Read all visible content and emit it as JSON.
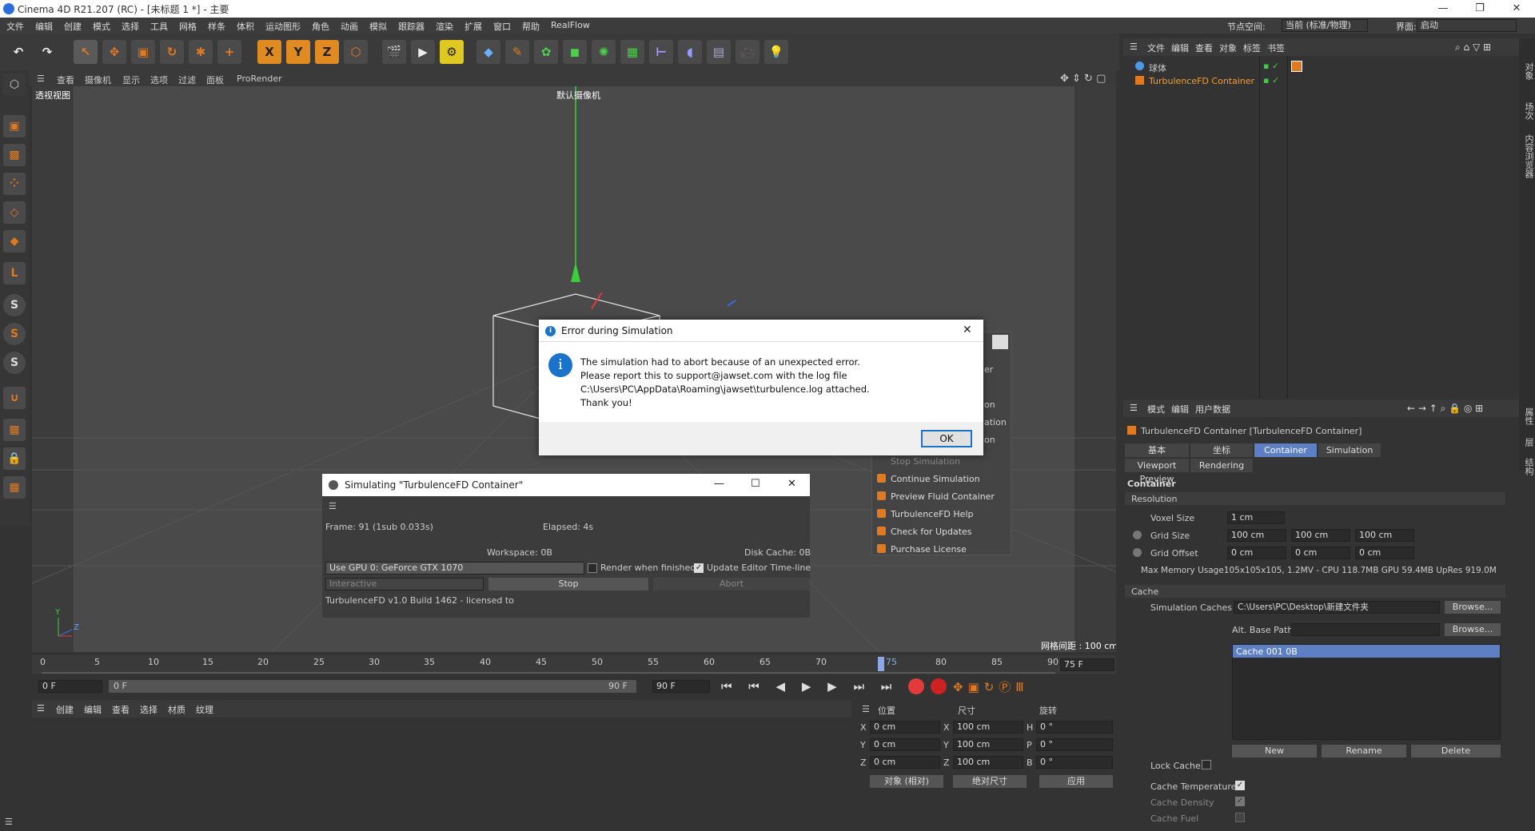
{
  "window": {
    "title": "Cinema 4D R21.207 (RC) - [未标题 1 *] - 主要"
  },
  "menubar": {
    "items": [
      "文件",
      "编辑",
      "创建",
      "模式",
      "选择",
      "工具",
      "网格",
      "样条",
      "体积",
      "运动图形",
      "角色",
      "动画",
      "模拟",
      "跟踪器",
      "渲染",
      "扩展",
      "窗口",
      "帮助",
      "RealFlow"
    ],
    "node_space_label": "节点空间:",
    "node_space_value": "当前 (标准/物理)",
    "interface_label": "界面:",
    "interface_value": "启动"
  },
  "viewport": {
    "menu": [
      "查看",
      "摄像机",
      "显示",
      "选项",
      "过滤",
      "面板",
      "ProRender"
    ],
    "view_name": "透视视图",
    "camera_label": "默认摄像机",
    "grid_spacing": "网格间距 : 100 cm"
  },
  "object_manager": {
    "menu": [
      "文件",
      "编辑",
      "查看",
      "对象",
      "标签",
      "书签"
    ],
    "objects": [
      "球体",
      "TurbulenceFD Container"
    ]
  },
  "attribute_manager": {
    "menu": [
      "模式",
      "编辑",
      "用户数据"
    ],
    "object_title": "TurbulenceFD Container [TurbulenceFD Container]",
    "tabs": [
      "基本",
      "坐标",
      "Container",
      "Simulation"
    ],
    "subtabs": [
      "Viewport Preview",
      "Rendering"
    ],
    "section": "Container",
    "resolution_group": "Resolution",
    "voxel_size_label": "Voxel Size",
    "voxel_size": "1 cm",
    "grid_size_label": "Grid Size",
    "grid_size": [
      "100 cm",
      "100 cm",
      "100 cm"
    ],
    "grid_offset_label": "Grid Offset",
    "grid_offset": [
      "0 cm",
      "0 cm",
      "0 cm"
    ],
    "max_memory": "Max Memory Usage105x105x105, 1.2MV - CPU 118.7MB GPU 59.4MB UpRes 919.0M",
    "cache_group": "Cache",
    "sim_caches_label": "Simulation Caches",
    "sim_caches_path": "C:\\Users\\PC\\Desktop\\新建文件夹",
    "browse": "Browse...",
    "alt_base_label": "Alt. Base Path",
    "cache_item": "Cache 001 0B",
    "btn_new": "New",
    "btn_rename": "Rename",
    "btn_delete": "Delete",
    "lock_cache": "Lock Cache",
    "cache_temperature": "Cache Temperature",
    "cache_density": "Cache Density",
    "cache_fuel": "Cache Fuel"
  },
  "timeline": {
    "ticks": [
      "0",
      "5",
      "10",
      "15",
      "20",
      "25",
      "30",
      "35",
      "40",
      "45",
      "50",
      "55",
      "60",
      "65",
      "70",
      "75",
      "80",
      "85",
      "90"
    ],
    "current_frame_marker": "75",
    "current_frame_field": "75 F",
    "start_field": "0 F",
    "range_start": "0 F",
    "range_end": "90 F",
    "end_field": "90 F"
  },
  "material_manager": {
    "menu": [
      "创建",
      "编辑",
      "查看",
      "选择",
      "材质",
      "纹理"
    ]
  },
  "coordinates": {
    "headers": [
      "位置",
      "尺寸",
      "旋转"
    ],
    "pos": {
      "X": "0 cm",
      "Y": "0 cm",
      "Z": "0 cm"
    },
    "size": {
      "X": "100 cm",
      "Y": "100 cm",
      "Z": "100 cm"
    },
    "rot": {
      "H": "0 °",
      "P": "0 °",
      "B": "0 °"
    },
    "mode_select": "对象 (相对)",
    "size_select": "绝对尺寸",
    "apply": "应用"
  },
  "context_menu": {
    "items": [
      "Stop Simulation",
      "Continue Simulation",
      "Preview Fluid Container",
      "TurbulenceFD Help",
      "Check for Updates",
      "Purchase License"
    ],
    "partial": [
      "er",
      "on",
      "ation",
      "on"
    ]
  },
  "sim_window": {
    "title": "Simulating \"TurbulenceFD Container\"",
    "frame": "Frame: 91 (1sub 0.033s)",
    "elapsed": "Elapsed: 4s",
    "workspace": "Workspace: 0B",
    "disk_cache": "Disk Cache: 0B",
    "gpu_select": "Use GPU 0: GeForce GTX 1070",
    "render_when_finished": "Render when finished",
    "update_timeline": "Update Editor Time-line",
    "mode_select": "Interactive",
    "stop": "Stop",
    "abort": "Abort",
    "footer": "TurbulenceFD v1.0 Build 1462 - licensed to"
  },
  "error_dialog": {
    "title": "Error during Simulation",
    "line1": "The simulation had to abort because of an unexpected error.",
    "line2": "Please report this to support@jawset.com with the log file",
    "line3": "C:\\Users\\PC\\AppData\\Roaming\\jawset\\turbulence.log attached.",
    "line4": "Thank you!",
    "ok": "OK"
  },
  "right_side_tabs": [
    "对象",
    "场次",
    "内容浏览器",
    "属性",
    "层",
    "结构"
  ],
  "colors": {
    "accent": "#5d7fc4",
    "turbulence_orange": "#e07a22",
    "dialog_icon": "#1a73c9"
  }
}
